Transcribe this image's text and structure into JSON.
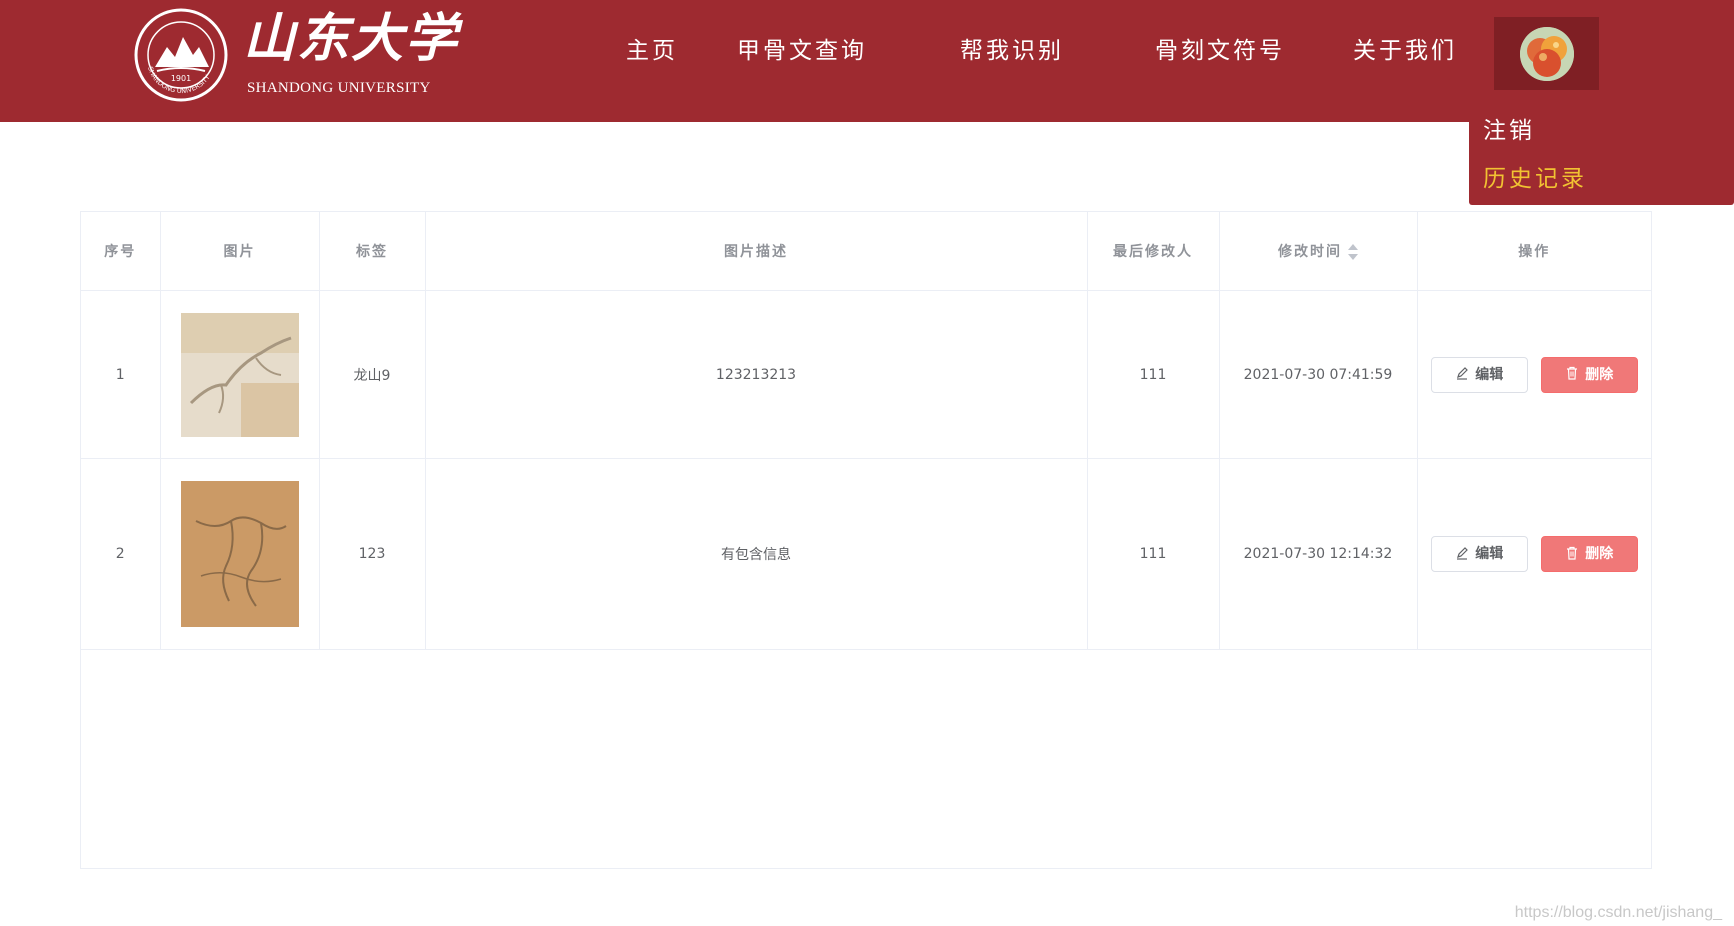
{
  "header": {
    "logo_name": "山东大学",
    "logo_sub": "SHANDONG UNIVERSITY",
    "logo_year": "1901",
    "logo_ring": "SHANDONG UNIVERSITY",
    "background": "#9e2a30"
  },
  "nav": {
    "home": "主页",
    "oracle_query": "甲骨文查询",
    "help_identify": "帮我识别",
    "bone_symbols": "骨刻文符号",
    "about_us": "关于我们"
  },
  "user_menu": {
    "avatar_icon": "apple-avatar",
    "logout": "注销",
    "history": "历史记录",
    "history_color": "#f1c232"
  },
  "table": {
    "columns": {
      "index": "序号",
      "image": "图片",
      "tag": "标签",
      "description": "图片描述",
      "modifier": "最后修改人",
      "modified_time": "修改时间",
      "actions": "操作"
    },
    "rows": [
      {
        "index": "1",
        "tag": "龙山9",
        "description": "123213213",
        "modifier": "111",
        "modified_time": "2021-07-30 07:41:59",
        "edit_label": "编辑",
        "delete_label": "删除"
      },
      {
        "index": "2",
        "tag": "123",
        "description": "有包含信息",
        "modifier": "111",
        "modified_time": "2021-07-30 12:14:32",
        "edit_label": "编辑",
        "delete_label": "删除"
      }
    ]
  },
  "watermark": "https://blog.csdn.net/jishang_"
}
